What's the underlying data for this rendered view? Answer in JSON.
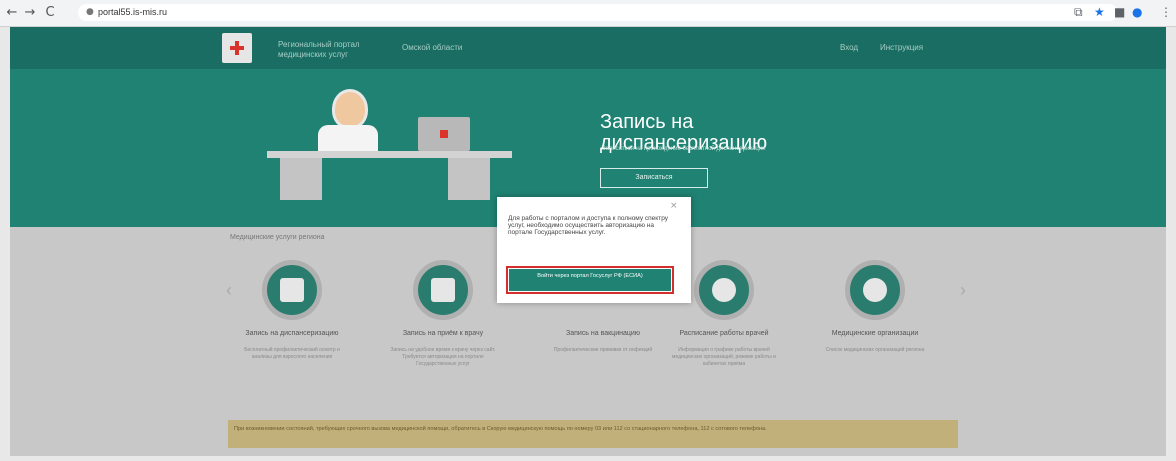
{
  "browser": {
    "back": "←",
    "forward": "→",
    "reload": "C",
    "url": "portal55.is-mis.ru"
  },
  "header": {
    "portal_name": "Региональный портал медицинских услуг",
    "region": "Омской области",
    "links": [
      "Вход",
      "Инструкция"
    ]
  },
  "hero": {
    "title": "Запись на диспансеризацию",
    "subtitle": "Записаться на прохождение бесплатной диспансеризации",
    "button": "Записаться"
  },
  "section_title": "Медицинские услуги региона",
  "services": [
    {
      "title": "Запись на диспансеризацию",
      "desc": "Бесплатный профилактический осмотр и анализы для взрослого населения"
    },
    {
      "title": "Запись на приём к врачу",
      "desc": "Запись на удобное время к врачу через сайт. Требуется авторизация на портале Государственных услуг"
    },
    {
      "title": "Запись на вакцинацию",
      "desc": "Профилактические прививки от инфекций"
    },
    {
      "title": "Расписание работы врачей",
      "desc": "Информация о графике работы врачей медицинских организаций, режиме работы и кабинетах приёма"
    },
    {
      "title": "Медицинские организации",
      "desc": "Список медицинских организаций региона"
    }
  ],
  "notice": "При возникновении состояний, требующих срочного вызова медицинской помощи, обратитесь в Скорую медицинскую помощь по номеру 03 или 112 со стационарного телефона, 112 с сотового телефона.",
  "modal": {
    "close": "×",
    "text": "Для работы с порталом и доступа к полному спектру услуг, необходимо осуществить авторизацию на портале Государственных услуг.",
    "button": "Войти через портал Госуслуг РФ (ЕСИА)"
  }
}
